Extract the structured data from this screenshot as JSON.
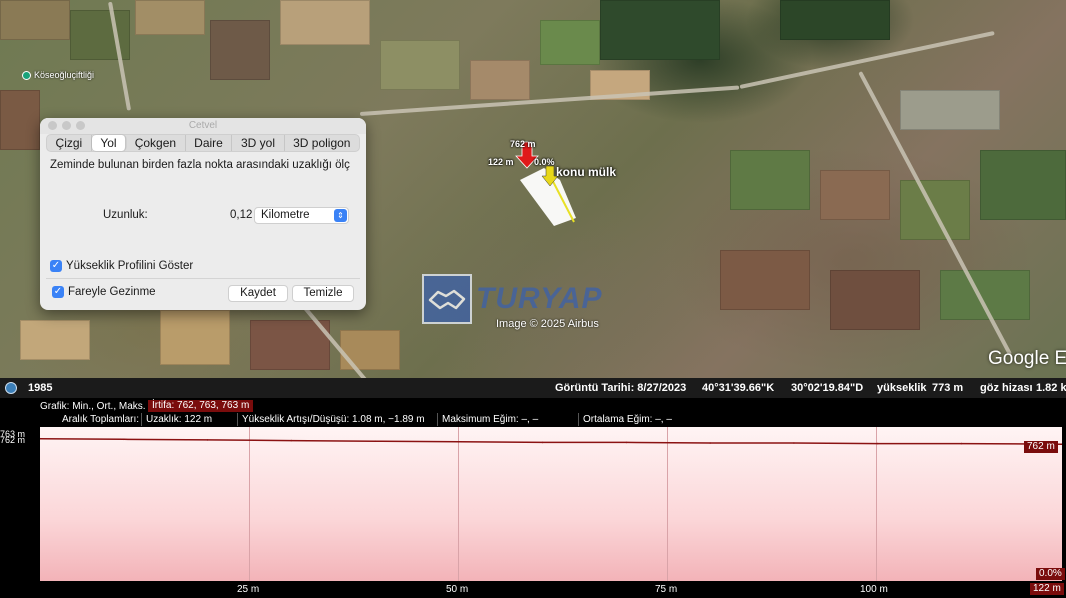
{
  "map": {
    "place_label": "Köseoğluçiftliği",
    "parcel_label": "konu mülk",
    "segment_length": "762 m",
    "segment_side": "122 m",
    "segment_grade": "0.0%",
    "watermark": "TURYAP",
    "imagery_credit": "Image © 2025 Airbus",
    "google_logo": "Google Ea"
  },
  "status_bar": {
    "year": "1985",
    "imagery_date": "Görüntü Tarihi: 8/27/2023",
    "lat": "40°31'39.66\"K",
    "lon": "30°02'19.84\"D",
    "elevation_label": "yükseklik",
    "elevation_value": "773 m",
    "eye_label": "göz hizası",
    "eye_value": "1.82 k"
  },
  "ruler": {
    "title": "Cetvel",
    "tabs": [
      "Çizgi",
      "Yol",
      "Çokgen",
      "Daire",
      "3D yol",
      "3D poligon"
    ],
    "active_tab": "Yol",
    "description": "Zeminde bulunan birden fazla nokta arasındaki uzaklığı ölç",
    "length_label": "Uzunluk:",
    "length_value": "0,12",
    "unit": "Kilometre",
    "show_elevation_profile": "Yükseklik Profilini Göster",
    "mouse_navigation": "Fareyle Gezinme",
    "save_button": "Kaydet",
    "clear_button": "Temizle"
  },
  "profile": {
    "graph_label": "Grafik: Min., Ort., Maks.",
    "altitude_summary": "İrtifa: 762, 763, 763 m",
    "range_totals_label": "Aralık Toplamları:",
    "distance": "Uzaklık: 122 m",
    "elevation_gain_loss": "Yükseklik Artışı/Düşüşü: 1.08 m, −1.89 m",
    "max_slope": "Maksimum Eğim: –, –",
    "avg_slope": "Ortalama Eğim: –, –",
    "y_labels": [
      "763 m",
      "762 m"
    ],
    "x_labels": [
      "25 m",
      "50 m",
      "75 m",
      "100 m"
    ],
    "end_distance": "122 m",
    "end_grade": "0.0%",
    "cursor_elevation": "762 m"
  },
  "chart_data": {
    "type": "area",
    "x": [
      0,
      10,
      20,
      30,
      40,
      50,
      60,
      70,
      80,
      90,
      100,
      110,
      122
    ],
    "values": [
      763.1,
      763.0,
      762.9,
      762.8,
      762.7,
      762.6,
      762.5,
      762.5,
      762.4,
      762.4,
      762.3,
      762.3,
      762.2
    ],
    "xlim": [
      0,
      122
    ],
    "ylim": [
      740,
      765
    ],
    "xlabel": "",
    "ylabel": "",
    "colors": {
      "line": "#8b1212",
      "fill": "#f7c4c8"
    }
  }
}
